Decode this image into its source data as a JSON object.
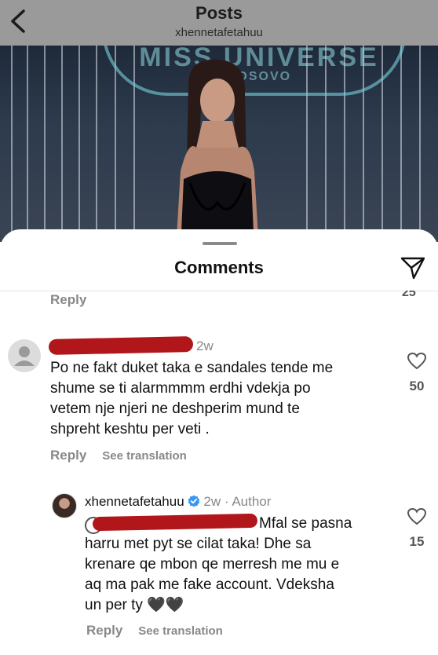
{
  "header": {
    "title": "Posts",
    "username": "xhennetafetahuu"
  },
  "photo": {
    "sign_text": "MISS UNIVERSE",
    "sign_sub": "KOSOVO"
  },
  "sheet": {
    "title": "Comments"
  },
  "previous": {
    "reply_label": "Reply",
    "like_count_partial": "25"
  },
  "comments": [
    {
      "time": "2w",
      "text": [
        "Po ne fakt duket taka e sandales tende me",
        "shume se ti alarmmmm erdhi vdekja po",
        "vetem nje njeri ne deshperim mund te",
        "shpreht keshtu per veti ."
      ],
      "reply_label": "Reply",
      "see_translation": "See translation",
      "likes": "50"
    }
  ],
  "reply": {
    "username": "xhennetafetahuu",
    "time": "2w",
    "author_label": "Author",
    "text_first": "Mfal se pasna",
    "text": [
      "harru met pyt se cilat taka! Dhe sa",
      "krenare qe mbon qe merresh me mu e",
      "aq ma pak me fake account. Vdeksha",
      "un per ty 🖤🖤"
    ],
    "reply_label": "Reply",
    "see_translation": "See translation",
    "likes": "15"
  },
  "colors": {
    "verified": "#3897f0",
    "redaction": "#b0161a",
    "muted": "#888888"
  }
}
